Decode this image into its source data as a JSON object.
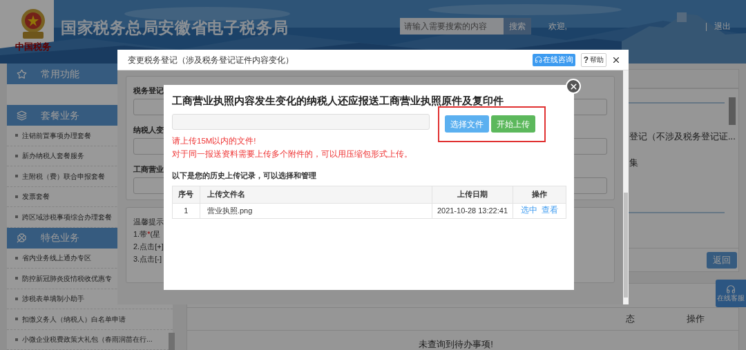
{
  "header": {
    "title": "国家税务总局安徽省电子税务局",
    "logo_text": "中国税务",
    "search": {
      "placeholder": "请输入需要搜索的内容",
      "button": "搜索"
    },
    "welcome": "欢迎,",
    "separator": "|",
    "logout": "退出"
  },
  "sidebar": {
    "sections": [
      {
        "title": "常用功能"
      },
      {
        "title": "套餐业务",
        "items": [
          "注销前置事项办理套餐",
          "新办纳税人套餐服务",
          "主附税（费）联合申报套餐",
          "发票套餐",
          "跨区域涉税事项综合办理套餐"
        ]
      },
      {
        "title": "特色业务",
        "items": [
          "省内业务线上通办专区",
          "防控新冠肺炎疫情税收优惠专",
          "涉税表单填制小助手",
          "扣缴义务人（纳税人）白名单申请",
          "小微企业税费政策大礼包（春雨润苗在行..."
        ]
      }
    ]
  },
  "main": {
    "panel_lines": [
      "登记（不涉及税务登记证...",
      "集"
    ],
    "back_button": "返回",
    "todo": {
      "columns": [
        "态",
        "操作"
      ],
      "empty": "未查询到待办事项!"
    }
  },
  "float_button": "在线客服",
  "dialog": {
    "title": "变更税务登记（涉及税务登记证件内容变化）",
    "consult": "在线咨询",
    "help": {
      "mark": "?",
      "label": "帮助"
    },
    "form_labels": [
      "税务登记",
      "纳税人变",
      "工商营业"
    ],
    "tips": [
      {
        "before": "温馨提示"
      },
      {
        "before": "1.带",
        "star": "*",
        "after": "(星"
      },
      {
        "before": "2.点击[+]"
      },
      {
        "before": "3.点击[-]"
      }
    ]
  },
  "upload": {
    "heading": "工商营业执照内容发生变化的纳税人还应报送工商营业执照原件及复印件",
    "buttons": [
      {
        "kind": "choose",
        "label": "选择文件"
      },
      {
        "kind": "start",
        "label": "开始上传"
      }
    ],
    "notes": [
      "请上传15M以内的文件!",
      "对于同一报送资料需要上传多个附件的，可以用压缩包形式上传。"
    ],
    "history_label": "以下是您的历史上传记录，可以选择和管理",
    "table": {
      "columns": [
        "序号",
        "上传文件名",
        "上传日期",
        "操作"
      ],
      "rows": [
        {
          "index": "1",
          "filename": "营业执照.png",
          "date": "2021-10-28 13:22:41",
          "actions": [
            "选中",
            "查看"
          ]
        }
      ]
    }
  }
}
